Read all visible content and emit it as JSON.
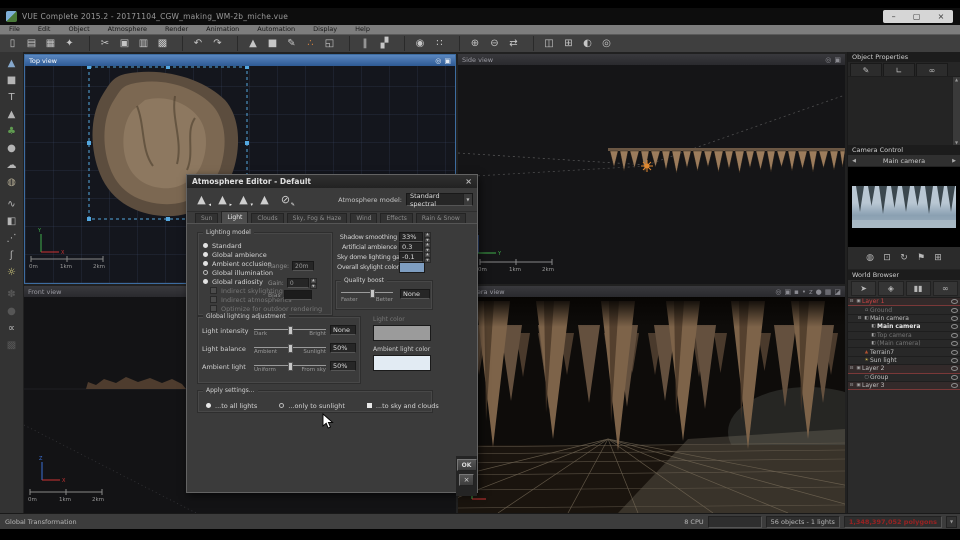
{
  "window": {
    "title": "VUE Complete 2015.2 - 20171104_CGW_making_WM-2b_miche.vue",
    "minimize": "–",
    "maximize": "▢",
    "close": "×"
  },
  "menus": [
    "File",
    "Edit",
    "Object",
    "Atmosphere",
    "Render",
    "Animation",
    "Automation",
    "Display",
    "Help"
  ],
  "main_toolbar": [
    {
      "name": "new-scene-icon",
      "glyph": "▯",
      "cls": ""
    },
    {
      "name": "open-scene-icon",
      "glyph": "▤",
      "cls": ""
    },
    {
      "name": "save-scene-icon",
      "glyph": "▦",
      "cls": ""
    },
    {
      "name": "collect-scene-icon",
      "glyph": "✦",
      "cls": ""
    },
    {
      "name": "cut-icon",
      "glyph": "✂",
      "cls": "gap"
    },
    {
      "name": "copy-icon",
      "glyph": "▣",
      "cls": ""
    },
    {
      "name": "paste-icon",
      "glyph": "▥",
      "cls": ""
    },
    {
      "name": "duplicate-icon",
      "glyph": "▩",
      "cls": ""
    },
    {
      "name": "undo-icon",
      "glyph": "↶",
      "cls": "gap"
    },
    {
      "name": "redo-icon",
      "glyph": "↷",
      "cls": ""
    },
    {
      "name": "add-terrain-icon",
      "glyph": "▲",
      "cls": "gap"
    },
    {
      "name": "add-object-icon",
      "glyph": "■",
      "cls": ""
    },
    {
      "name": "edit-path-icon",
      "glyph": "✎",
      "cls": ""
    },
    {
      "name": "material-editor-icon",
      "glyph": "∴",
      "cls": "orange"
    },
    {
      "name": "animation-wizard-icon",
      "glyph": "◱",
      "cls": ""
    },
    {
      "name": "align-objects-icon",
      "glyph": "‖",
      "cls": "gap"
    },
    {
      "name": "mirror-objects-icon",
      "glyph": "▞",
      "cls": ""
    },
    {
      "name": "atmosphere-globe-icon",
      "glyph": "◉",
      "cls": "gap"
    },
    {
      "name": "snap-grid-icon",
      "glyph": "∷",
      "cls": ""
    },
    {
      "name": "zoom-in-icon",
      "glyph": "⊕",
      "cls": "gap"
    },
    {
      "name": "zoom-out-icon",
      "glyph": "⊖",
      "cls": ""
    },
    {
      "name": "swap-views-icon",
      "glyph": "⇄",
      "cls": ""
    },
    {
      "name": "single-view-icon",
      "glyph": "◫",
      "cls": "gap"
    },
    {
      "name": "quad-view-icon",
      "glyph": "⊞",
      "cls": ""
    },
    {
      "name": "render-display-icon",
      "glyph": "◐",
      "cls": ""
    },
    {
      "name": "render-camera-icon",
      "glyph": "◎",
      "cls": ""
    }
  ],
  "left_toolbar": [
    {
      "name": "heightfield-terrain-icon",
      "glyph": "▲",
      "cls": "blue"
    },
    {
      "name": "cube-primitive-icon",
      "glyph": "■",
      "cls": ""
    },
    {
      "name": "text-object-icon",
      "glyph": "T",
      "cls": ""
    },
    {
      "name": "procedural-terrain-icon",
      "glyph": "▲",
      "cls": ""
    },
    {
      "name": "vegetation-icon",
      "glyph": "♣",
      "cls": "green"
    },
    {
      "name": "rock-icon",
      "glyph": "●",
      "cls": ""
    },
    {
      "name": "metacloud-icon",
      "glyph": "☁",
      "cls": ""
    },
    {
      "name": "planet-icon",
      "glyph": "◍",
      "cls": "tan"
    },
    {
      "name": "bezier-curve-icon",
      "glyph": "∿",
      "cls": "sp"
    },
    {
      "name": "alpha-plane-icon",
      "glyph": "◧",
      "cls": ""
    },
    {
      "name": "spline-icon",
      "glyph": "⋰",
      "cls": ""
    },
    {
      "name": "wind-affector-icon",
      "glyph": "ʃ",
      "cls": ""
    },
    {
      "name": "light-icon",
      "glyph": "☼",
      "cls": "sun"
    },
    {
      "name": "ecosystem-icon",
      "glyph": "✽",
      "cls": "dis sp"
    },
    {
      "name": "sphere-icon",
      "glyph": "●",
      "cls": "dis"
    },
    {
      "name": "joint-icon",
      "glyph": "∝",
      "cls": ""
    },
    {
      "name": "group-icon",
      "glyph": "▩",
      "cls": "dis"
    }
  ],
  "viewports": {
    "top": {
      "label": "Top view",
      "ruler": [
        "0m",
        "1km",
        "2km"
      ],
      "icons": [
        {
          "name": "zoom-view-icon",
          "glyph": "◎"
        },
        {
          "name": "maximize-view-icon",
          "glyph": "▣"
        }
      ]
    },
    "side": {
      "label": "Side view",
      "ruler": [
        "0m",
        "1km",
        "2km"
      ],
      "icons": [
        {
          "name": "zoom-view-icon",
          "glyph": "◎"
        },
        {
          "name": "maximize-view-icon",
          "glyph": "▣"
        }
      ]
    },
    "front": {
      "label": "Front view",
      "ruler": [
        "0m",
        "1km",
        "2km"
      ],
      "icons": [
        {
          "name": "zoom-view-icon",
          "glyph": "◎"
        },
        {
          "name": "maximize-view-icon",
          "glyph": "▣"
        }
      ]
    },
    "camera": {
      "label": "Camera view",
      "icons": [
        {
          "name": "zoom-view-icon",
          "glyph": "◎"
        },
        {
          "name": "snapshot-icon",
          "glyph": "▣"
        },
        {
          "name": "options-icon",
          "glyph": "▪"
        },
        {
          "name": "dot-icon",
          "glyph": "•"
        },
        {
          "name": "depth-icon",
          "glyph": "z"
        },
        {
          "name": "sphere-preview-icon",
          "glyph": "●"
        },
        {
          "name": "grid-overlay-icon",
          "glyph": "▦"
        },
        {
          "name": "paint-overlay-icon",
          "glyph": "◪"
        }
      ]
    }
  },
  "dialog": {
    "title": "Atmosphere Editor - Default",
    "close": "×",
    "icons": [
      {
        "name": "previous-atmosphere-icon",
        "glyph": "▲",
        "sub": "◂"
      },
      {
        "name": "next-atmosphere-icon",
        "glyph": "▲",
        "sub": "▸"
      },
      {
        "name": "load-atmosphere-icon",
        "glyph": "▲",
        "sub": "▾"
      },
      {
        "name": "save-atmosphere-icon",
        "glyph": "▲",
        "sub": ""
      },
      {
        "name": "reset-atmosphere-icon",
        "glyph": "⊘",
        "sub": "✎"
      }
    ],
    "model_label": "Atmosphere model:",
    "model_value": "Standard spectral",
    "tabs": [
      {
        "label": "Sun",
        "cls": ""
      },
      {
        "label": "Light",
        "cls": "active"
      },
      {
        "label": "Clouds",
        "cls": ""
      },
      {
        "label": "Sky, Fog & Haze",
        "cls": ""
      },
      {
        "label": "Wind",
        "cls": ""
      },
      {
        "label": "Effects",
        "cls": ""
      },
      {
        "label": "Rain & Snow",
        "cls": ""
      }
    ],
    "lighting": {
      "title": "Lighting model",
      "options": [
        {
          "label": "Standard",
          "mark": "dot"
        },
        {
          "label": "Global ambience",
          "mark": "dot"
        },
        {
          "label": "Ambient occlusion",
          "mark": "dot"
        },
        {
          "label": "Global illumination",
          "mark": "circle"
        },
        {
          "label": "Global radiosity",
          "mark": "dot"
        }
      ],
      "sub_options": [
        {
          "label": "Indirect skylighting"
        },
        {
          "label": "Indirect atmospherics"
        },
        {
          "label": "Optimize for outdoor rendering"
        }
      ],
      "range_label": "Range:",
      "range_value": "20m",
      "gain_label": "Gain:",
      "gain_value": "0",
      "bias_label": "Bias"
    },
    "fields": [
      {
        "label": "Shadow smoothing",
        "value": "33%"
      },
      {
        "label": "Artificial ambience",
        "value": "0.3"
      },
      {
        "label": "Sky dome lighting gain",
        "value": "-0.1"
      }
    ],
    "skylight": {
      "label": "Overall skylight color",
      "color": "#7e9dc0"
    },
    "quality": {
      "title": "Quality boost",
      "left": "Faster",
      "right": "Better",
      "value": "None"
    },
    "adjust": {
      "title": "Global lighting adjustment",
      "rows": [
        {
          "label": "Light intensity",
          "min": "Dark",
          "max": "Bright",
          "value": "None"
        },
        {
          "label": "Light balance",
          "min": "Ambient",
          "max": "Sunlight",
          "value": "50%"
        },
        {
          "label": "Ambient light",
          "min": "Uniform",
          "max": "From sky",
          "value": "50%"
        }
      ]
    },
    "light_color": {
      "label": "Light color",
      "color": "#9b9b9b"
    },
    "ambient_color": {
      "label": "Ambient light color",
      "color": "#e2ebf3"
    },
    "apply": {
      "title": "Apply settings...",
      "options": [
        {
          "label": "...to all lights",
          "mark": "radio-on"
        },
        {
          "label": "...only to sunlight",
          "mark": "radio-off"
        },
        {
          "label": "...to sky and clouds",
          "mark": "check-on"
        }
      ]
    },
    "ok": "OK",
    "cancel": "×"
  },
  "right_panel": {
    "object_properties": {
      "title": "Object Properties",
      "tabs": [
        {
          "name": "aspect-tab-icon",
          "glyph": "✎"
        },
        {
          "name": "numerics-tab-icon",
          "glyph": "∟"
        },
        {
          "name": "links-tab-icon",
          "glyph": "∞"
        }
      ]
    },
    "camera_control": {
      "title": "Camera Control",
      "prev": "◀",
      "next": "▶",
      "camera": "Main camera",
      "buttons": [
        {
          "name": "orbit-camera-icon",
          "glyph": "◍"
        },
        {
          "name": "target-camera-icon",
          "glyph": "⊡"
        },
        {
          "name": "rotate-camera-icon",
          "glyph": "↻"
        },
        {
          "name": "flag-camera-icon",
          "glyph": "⚑"
        },
        {
          "name": "grid-camera-icon",
          "glyph": "⊞"
        }
      ]
    },
    "world_browser": {
      "title": "World Browser",
      "toolbar": [
        {
          "name": "objects-tab-icon",
          "glyph": "➤"
        },
        {
          "name": "materials-tab-icon",
          "glyph": "◈"
        },
        {
          "name": "statistics-tab-icon",
          "glyph": "▮▮"
        },
        {
          "name": "links-tab-icon",
          "glyph": "∞"
        }
      ],
      "tree": [
        {
          "exp": "⊟",
          "icon": "▣",
          "label": "Layer 1",
          "cls": "layer red"
        },
        {
          "exp": "",
          "icon": "▫",
          "label": "Ground",
          "cls": "dim d1"
        },
        {
          "exp": "⊟",
          "icon": "◧",
          "label": "Main camera",
          "cls": "normal d1"
        },
        {
          "exp": "",
          "icon": "◧",
          "label": "Main camera",
          "cls": "bright d2"
        },
        {
          "exp": "",
          "icon": "◧",
          "label": "Top camera",
          "cls": "dim d2"
        },
        {
          "exp": "",
          "icon": "◧",
          "label": "(Main camera)",
          "cls": "dim d2"
        },
        {
          "exp": "",
          "icon": "▲",
          "label": "Terrain7",
          "cls": "normal d1 t-red"
        },
        {
          "exp": "",
          "icon": "☀",
          "label": "Sun light",
          "cls": "normal d1 t-sun"
        },
        {
          "exp": "⊟",
          "icon": "▣",
          "label": "Layer 2",
          "cls": "layer"
        },
        {
          "exp": "",
          "icon": "▢",
          "label": "Group",
          "cls": "normal d1"
        },
        {
          "exp": "⊟",
          "icon": "▣",
          "label": "Layer 3",
          "cls": "layer"
        }
      ]
    }
  },
  "status": {
    "left": "Global Transformation",
    "cpu": "8 CPU",
    "objects": "56 objects - 1 lights",
    "polygons": "1,348,397,052 polygons"
  }
}
